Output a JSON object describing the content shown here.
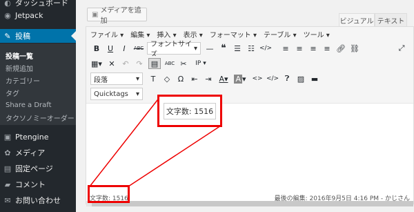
{
  "sidebar": {
    "items": [
      {
        "icon": "dashboard-icon",
        "glyph": "◐",
        "label": "ダッシュボード"
      },
      {
        "icon": "jetpack-icon",
        "glyph": "◉",
        "label": "Jetpack"
      },
      {
        "icon": "pin-icon",
        "glyph": "✎",
        "label": "投稿"
      },
      {
        "icon": "ptengine-icon",
        "glyph": "▣",
        "label": "Ptengine"
      },
      {
        "icon": "media-icon",
        "glyph": "✿",
        "label": "メディア"
      },
      {
        "icon": "page-icon",
        "glyph": "▤",
        "label": "固定ページ"
      },
      {
        "icon": "comment-icon",
        "glyph": "▰",
        "label": "コメント"
      },
      {
        "icon": "mail-icon",
        "glyph": "✉",
        "label": "お問い合わせ"
      }
    ],
    "submenu": [
      "投稿一覧",
      "新規追加",
      "カテゴリー",
      "タグ",
      "Share a Draft",
      "タクソノミーオーダー"
    ]
  },
  "editor": {
    "media_button": "メディアを追加",
    "tabs": {
      "visual": "ビジュアル",
      "text": "テキスト"
    },
    "menubar": [
      "ファイル ▾",
      "編集 ▾",
      "挿入 ▾",
      "表示 ▾",
      "フォーマット ▾",
      "テーブル ▾",
      "ツール ▾"
    ],
    "font_size_label": "フォントサイズ",
    "paragraph_label": "段落",
    "quicktags_label": "Quicktags",
    "word_count": "文字数: 1516",
    "last_edited": "最後の編集: 2016年9月5日 4:16 PM - かじさん",
    "callout_word_count": "文字数: 1516"
  },
  "colors": {
    "accent": "#0073aa",
    "callout": "#ee0000",
    "sidebar": "#23282d"
  }
}
